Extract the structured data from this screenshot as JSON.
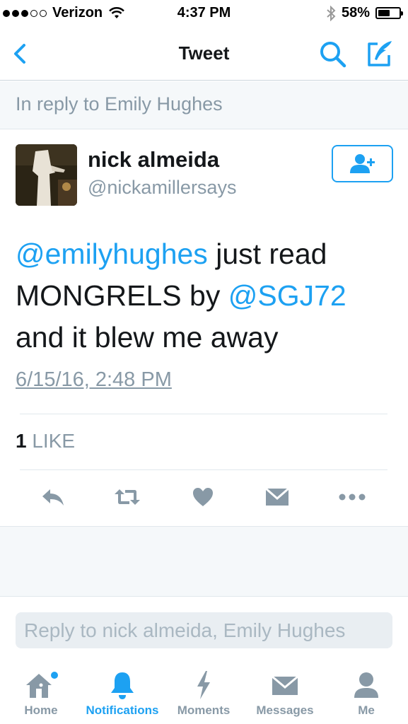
{
  "status_bar": {
    "carrier": "Verizon",
    "time": "4:37 PM",
    "battery": "58%",
    "battery_level": 0.58
  },
  "nav": {
    "title": "Tweet"
  },
  "in_reply_to": "In reply to Emily Hughes",
  "tweet": {
    "name": "nick almeida",
    "handle": "@nickamillersays",
    "text_parts": [
      {
        "text": "@emilyhughes",
        "mention": true
      },
      {
        "text": " just read MONGRELS by ",
        "mention": false
      },
      {
        "text": "@SGJ72",
        "mention": true
      },
      {
        "text": " and it blew me away",
        "mention": false
      }
    ],
    "timestamp": "6/15/16, 2:48 PM",
    "like_count": "1",
    "like_label": "LIKE"
  },
  "reply_placeholder": "Reply to nick almeida, Emily Hughes",
  "tabs": [
    {
      "label": "Home",
      "icon": "home-icon"
    },
    {
      "label": "Notifications",
      "icon": "bell-icon"
    },
    {
      "label": "Moments",
      "icon": "lightning-icon"
    },
    {
      "label": "Messages",
      "icon": "envelope-icon"
    },
    {
      "label": "Me",
      "icon": "person-icon"
    }
  ],
  "colors": {
    "accent": "#1da1f2",
    "muted": "#8899a6",
    "text": "#14171a"
  }
}
